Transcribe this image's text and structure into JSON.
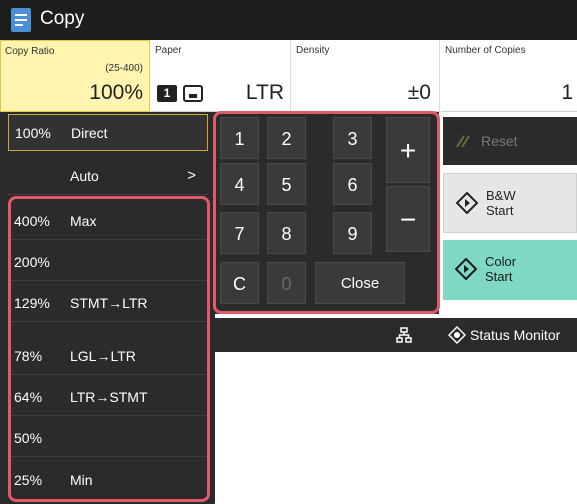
{
  "app": {
    "title": "Copy",
    "icon": "copy-icon"
  },
  "header": {
    "copy_ratio": {
      "label": "Copy Ratio",
      "range": "(25-400)",
      "value": "100%"
    },
    "paper": {
      "label": "Paper",
      "drawer_number": "1",
      "value": "LTR",
      "icons": [
        "paper-drawer-icon",
        "paper-tray-icon"
      ]
    },
    "density": {
      "label": "Density",
      "value": "±0"
    },
    "copies": {
      "label": "Number of Copies",
      "value": "1"
    }
  },
  "ratio_list": [
    {
      "percent": "100%",
      "name": "Direct",
      "selected": true
    },
    {
      "percent": "",
      "name": "Auto",
      "arrow": ">"
    },
    {
      "percent": "400%",
      "name": "Max"
    },
    {
      "percent": "200%",
      "name": ""
    },
    {
      "percent": "129%",
      "name": "STMT→LTR"
    },
    {
      "percent": "78%",
      "name": "LGL→LTR"
    },
    {
      "percent": "64%",
      "name": "LTR→STMT"
    },
    {
      "percent": "50%",
      "name": ""
    },
    {
      "percent": "25%",
      "name": "Min"
    }
  ],
  "keypad": {
    "keys": [
      "1",
      "2",
      "3",
      "4",
      "5",
      "6",
      "7",
      "8",
      "9",
      "C",
      "0"
    ],
    "plus": "+",
    "minus": "−",
    "close": "Close"
  },
  "actions": {
    "reset": "Reset",
    "bw_start": [
      "B&W",
      "Start"
    ],
    "color_start": [
      "Color",
      "Start"
    ]
  },
  "status": {
    "label": "Status Monitor",
    "icons": [
      "network-icon",
      "status-monitor-icon"
    ]
  },
  "colors": {
    "highlight": "#e05a6a",
    "selected_header": "#fff4b0",
    "color_start": "#7fd8c3",
    "dark_panel": "#2b2b2b"
  }
}
